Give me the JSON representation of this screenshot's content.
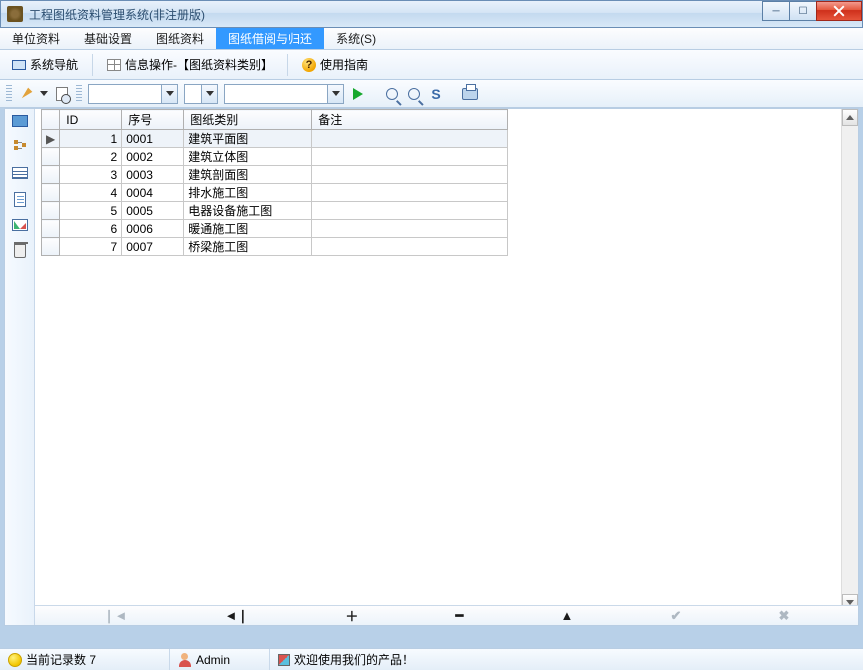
{
  "window": {
    "title": "工程图纸资料管理系统(非注册版)"
  },
  "menu": {
    "items": [
      "单位资料",
      "基础设置",
      "图纸资料",
      "图纸借阅与归还",
      "系统(S)"
    ],
    "active_index": 3
  },
  "toolrow": {
    "nav_label": "系统导航",
    "info_label": "信息操作-【图纸资料类别】",
    "help_label": "使用指南"
  },
  "grid": {
    "headers": {
      "id": "ID",
      "sn": "序号",
      "cat": "图纸类别",
      "note": "备注"
    },
    "rows": [
      {
        "id": "1",
        "sn": "0001",
        "cat": "建筑平面图",
        "note": ""
      },
      {
        "id": "2",
        "sn": "0002",
        "cat": "建筑立体图",
        "note": ""
      },
      {
        "id": "3",
        "sn": "0003",
        "cat": "建筑剖面图",
        "note": ""
      },
      {
        "id": "4",
        "sn": "0004",
        "cat": "排水施工图",
        "note": ""
      },
      {
        "id": "5",
        "sn": "0005",
        "cat": "电器设备施工图",
        "note": ""
      },
      {
        "id": "6",
        "sn": "0006",
        "cat": "暖通施工图",
        "note": ""
      },
      {
        "id": "7",
        "sn": "0007",
        "cat": "桥梁施工图",
        "note": ""
      }
    ],
    "selected_row": 0
  },
  "nav": {
    "first": "❘◄",
    "prev": "◄❘",
    "add": "＋",
    "remove": "━",
    "up": "▲",
    "commit": "✔",
    "last": "✖"
  },
  "status": {
    "count_label": "当前记录数 7",
    "user": "Admin",
    "welcome": "欢迎使用我们的产品！"
  }
}
